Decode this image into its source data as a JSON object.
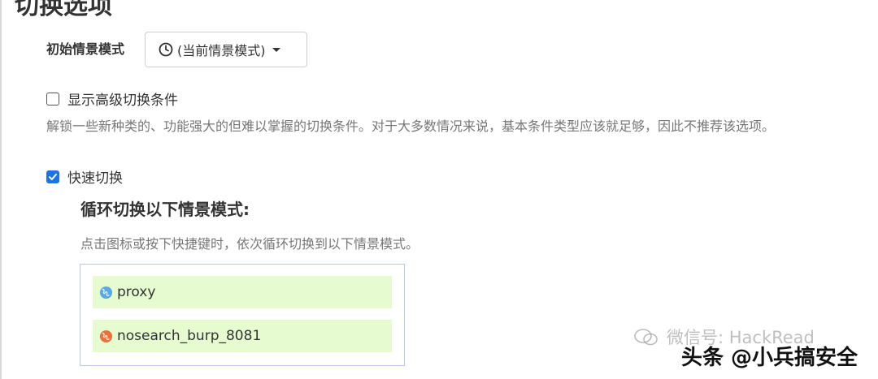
{
  "section": {
    "title": "切换选项"
  },
  "initial_profile": {
    "label": "初始情景模式",
    "selected": "(当前情景模式)",
    "icon": "clock-icon"
  },
  "advanced_conditions": {
    "label": "显示高级切换条件",
    "checked": false,
    "help": "解锁一些新种类的、功能强大的但难以掌握的切换条件。对于大多数情况来说，基本条件类型应该就足够，因此不推荐该选项。"
  },
  "quick_switch": {
    "label": "快速切换",
    "checked": true,
    "cycle_title": "循环切换以下情景模式:",
    "cycle_help": "点击图标或按下快捷键时，依次循环切换到以下情景模式。",
    "profiles": [
      {
        "name": "proxy",
        "icon": "globe-icon",
        "color": "#5aa9e6"
      },
      {
        "name": "nosearch_burp_8081",
        "icon": "globe-icon",
        "color": "#e8733a"
      }
    ]
  },
  "watermarks": {
    "wechat": "微信号: HackRead",
    "toutiao": "头条 @小兵搞安全"
  },
  "colors": {
    "accent": "#1a73e8",
    "profile_bg": "#e6fbd0",
    "muted_text": "#777777"
  }
}
